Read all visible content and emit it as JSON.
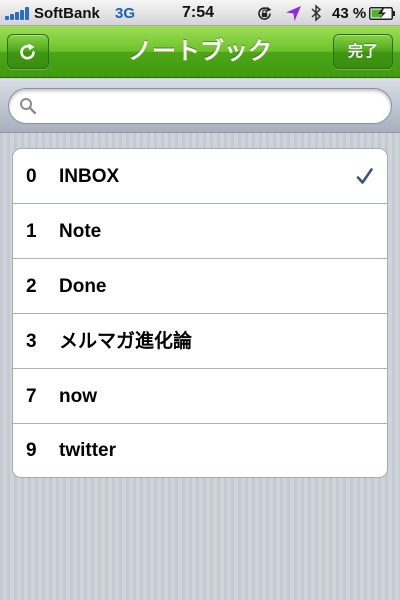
{
  "status_bar": {
    "carrier": "SoftBank",
    "network": "3G",
    "time": "7:54",
    "battery_percent": "43 %",
    "icons": [
      "signal-icon",
      "orientation-lock-icon",
      "location-icon",
      "bluetooth-icon",
      "battery-icon"
    ],
    "network_color": "#1f5fb5"
  },
  "nav_bar": {
    "title": "ノートブック",
    "left_button_icon": "refresh-icon",
    "done_label": "完了",
    "accent_color": "#4da616"
  },
  "search": {
    "placeholder": "",
    "value": "",
    "icon": "search-icon"
  },
  "notebooks": [
    {
      "index": "0",
      "name": "INBOX",
      "selected": true
    },
    {
      "index": "1",
      "name": "Note",
      "selected": false
    },
    {
      "index": "2",
      "name": "Done",
      "selected": false
    },
    {
      "index": "3",
      "name": "メルマガ進化論",
      "selected": false
    },
    {
      "index": "7",
      "name": "now",
      "selected": false
    },
    {
      "index": "9",
      "name": "twitter",
      "selected": false
    }
  ],
  "selection_icon": "checkmark-icon",
  "checkmark_color": "#3a5583"
}
